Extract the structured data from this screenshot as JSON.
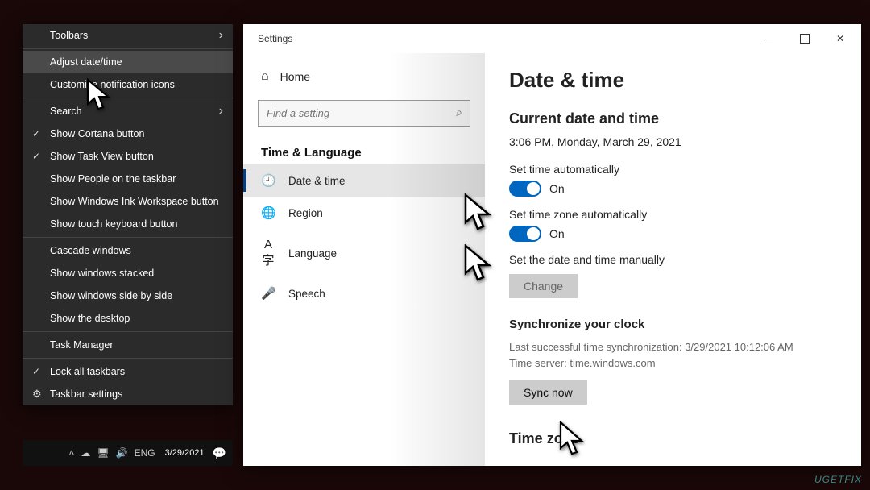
{
  "context_menu": {
    "items": [
      {
        "label": "Toolbars",
        "sub": true
      },
      {
        "sep": true
      },
      {
        "label": "Adjust date/time",
        "hover": true
      },
      {
        "label": "Customize notification icons"
      },
      {
        "sep": true
      },
      {
        "label": "Search",
        "sub": true
      },
      {
        "label": "Show Cortana button",
        "check": true
      },
      {
        "label": "Show Task View button",
        "check": true
      },
      {
        "label": "Show People on the taskbar"
      },
      {
        "label": "Show Windows Ink Workspace button"
      },
      {
        "label": "Show touch keyboard button"
      },
      {
        "sep": true
      },
      {
        "label": "Cascade windows"
      },
      {
        "label": "Show windows stacked"
      },
      {
        "label": "Show windows side by side"
      },
      {
        "label": "Show the desktop"
      },
      {
        "sep": true
      },
      {
        "label": "Task Manager"
      },
      {
        "sep": true
      },
      {
        "label": "Lock all taskbars",
        "check": true
      },
      {
        "label": "Taskbar settings",
        "gear": true
      }
    ]
  },
  "taskbar": {
    "lang": "ENG",
    "date": "3/29/2021"
  },
  "settings": {
    "title": "Settings",
    "home": "Home",
    "search_placeholder": "Find a setting",
    "section": "Time & Language",
    "nav": [
      {
        "icon": "🕘",
        "label": "Date & time",
        "active": true,
        "name": "date-time"
      },
      {
        "icon": "🌐",
        "label": "Region",
        "name": "region"
      },
      {
        "icon": "A字",
        "label": "Language",
        "name": "language"
      },
      {
        "icon": "🎤",
        "label": "Speech",
        "name": "speech"
      }
    ],
    "main": {
      "heading": "Date & time",
      "current_heading": "Current date and time",
      "current_value": "3:06 PM, Monday, March 29, 2021",
      "set_time_auto": {
        "label": "Set time automatically",
        "state": "On"
      },
      "set_tz_auto": {
        "label": "Set time zone automatically",
        "state": "On"
      },
      "manual": {
        "label": "Set the date and time manually",
        "button": "Change"
      },
      "sync": {
        "heading": "Synchronize your clock",
        "last": "Last successful time synchronization: 3/29/2021 10:12:06 AM",
        "server": "Time server: time.windows.com",
        "button": "Sync now"
      },
      "tz_heading": "Time zone"
    }
  },
  "watermark": "UGETFIX"
}
